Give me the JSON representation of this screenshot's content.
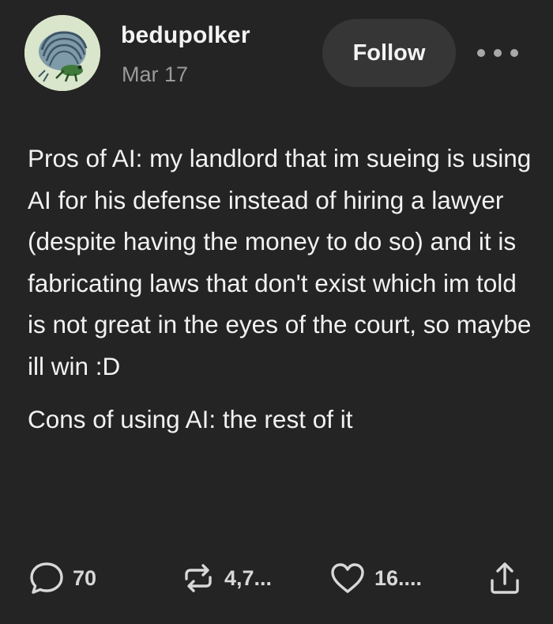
{
  "post": {
    "author": {
      "username": "bedupolker",
      "timestamp": "Mar 17",
      "avatar_icon": "pillbug-avatar"
    },
    "follow_label": "Follow",
    "more_icon": "more-dots-icon",
    "paragraphs": [
      "Pros of AI: my landlord that im sueing is using AI for his defense instead of hiring a lawyer (despite having the money to do so) and it is fabricating laws that don't exist which im told is not great in the eyes of the court, so maybe ill win :D",
      "Cons of using AI: the rest of it"
    ],
    "actions": {
      "reply": {
        "icon": "comment-bubble-icon",
        "count": "70"
      },
      "reblog": {
        "icon": "reblog-icon",
        "count": "4,7..."
      },
      "like": {
        "icon": "heart-icon",
        "count": "16...."
      },
      "share": {
        "icon": "share-icon"
      }
    }
  },
  "colors": {
    "background": "#242424",
    "text": "#f2f2f2",
    "muted": "#9a9a9a",
    "button": "#363636"
  }
}
